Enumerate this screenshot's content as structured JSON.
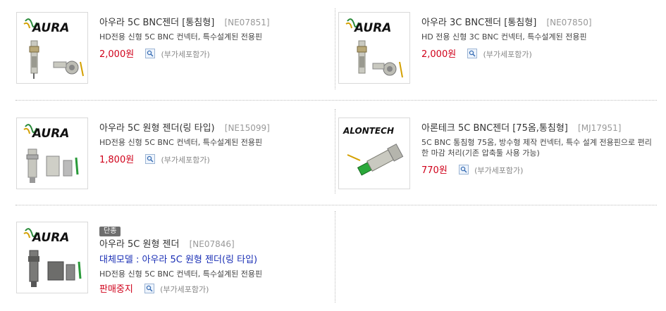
{
  "vat_label": "(부가세포함가)",
  "products": [
    {
      "brand": "AURA",
      "name": "아우라 5C BNC젠더 [통침형]",
      "code": "[NE07851]",
      "desc": "HD전용 신형 5C BNC 컨넥터, 특수설계된 전용핀",
      "price": "2,000원",
      "image": "bnc-straight-connector"
    },
    {
      "brand": "AURA",
      "name": "아우라 3C BNC젠더 [통침형]",
      "code": "[NE07850]",
      "desc": "HD 전용 신형 3C BNC 컨넥터, 특수설계된 전용핀",
      "price": "2,000원",
      "image": "bnc-straight-connector"
    },
    {
      "brand": "AURA",
      "name": "아우라 5C 원형 젠더(링 타입)",
      "code": "[NE15099]",
      "desc": "HD전용 신형 5C BNC 컨넥터, 특수설계된 전용핀",
      "price": "1,800원",
      "image": "bnc-ring-connector"
    },
    {
      "brand": "ALONTECH",
      "name": "아론테크 5C BNC젠더 [75옴,통침형]",
      "code": "[MJ17951]",
      "desc": "5C BNC 통침형 75옴, 방수형 제작 컨넥터, 특수 설계 전용핀으로 편리한 마감 처리(기존 압축툴 사용 가능)",
      "price": "770원",
      "image": "bnc-waterproof-connector"
    },
    {
      "brand": "AURA",
      "badge": "단종",
      "name": "아우라 5C 원형 젠더",
      "code": "[NE07846]",
      "alt": "대체모델 : 아우라 5C 원형 젠더(링 타입)",
      "desc": "HD전용 신형 5C BNC 컨넥터, 특수설계된 전용핀",
      "price": "판매중지",
      "image": "bnc-ring-connector-dark"
    }
  ]
}
